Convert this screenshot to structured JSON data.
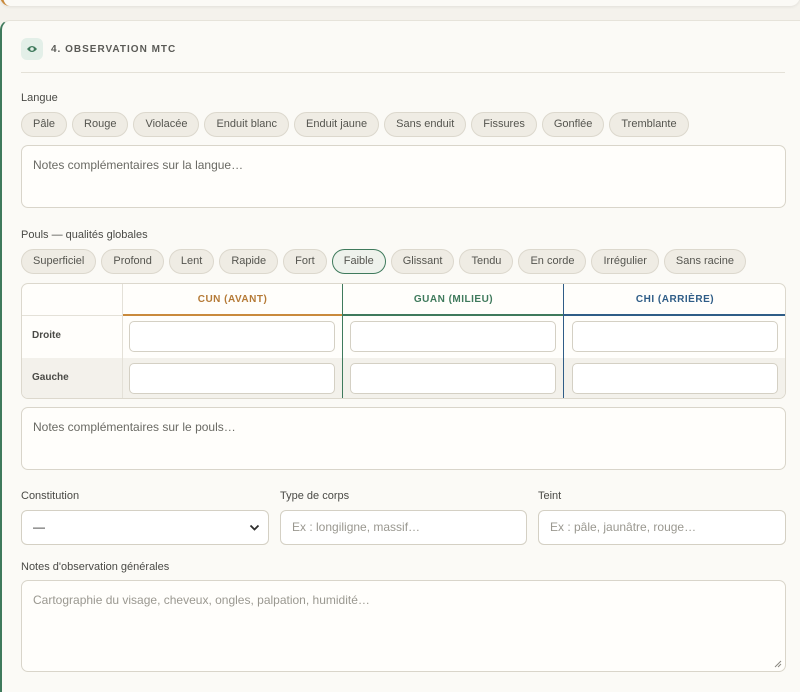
{
  "section": {
    "title": "4. OBSERVATION MTC",
    "icon": "eye-icon"
  },
  "langue": {
    "label": "Langue",
    "chips": [
      "Pâle",
      "Rouge",
      "Violacée",
      "Enduit blanc",
      "Enduit jaune",
      "Sans enduit",
      "Fissures",
      "Gonflée",
      "Tremblante"
    ],
    "notes_placeholder": "Notes complémentaires sur la langue…"
  },
  "pouls": {
    "label": "Pouls — qualités globales",
    "chips": [
      "Superficiel",
      "Profond",
      "Lent",
      "Rapide",
      "Fort",
      "Faible",
      "Glissant",
      "Tendu",
      "En corde",
      "Irrégulier",
      "Sans racine"
    ],
    "active_chip": "Faible",
    "table": {
      "columns": [
        "CUN (AVANT)",
        "GUAN (MILIEU)",
        "CHI (ARRIÈRE)"
      ],
      "rows": [
        "Droite",
        "Gauche"
      ],
      "colors": {
        "cun": "#c98a3c",
        "guan": "#3f7a5c",
        "chi": "#2f5d87"
      }
    },
    "notes_placeholder": "Notes complémentaires sur le pouls…"
  },
  "constitution": {
    "label": "Constitution",
    "value": "—"
  },
  "type_corps": {
    "label": "Type de corps",
    "placeholder": "Ex : longiligne, massif…"
  },
  "teint": {
    "label": "Teint",
    "placeholder": "Ex : pâle, jaunâtre, rouge…"
  },
  "notes_generales": {
    "label": "Notes d'observation générales",
    "placeholder": "Cartographie du visage, cheveux, ongles, palpation, humidité…"
  }
}
